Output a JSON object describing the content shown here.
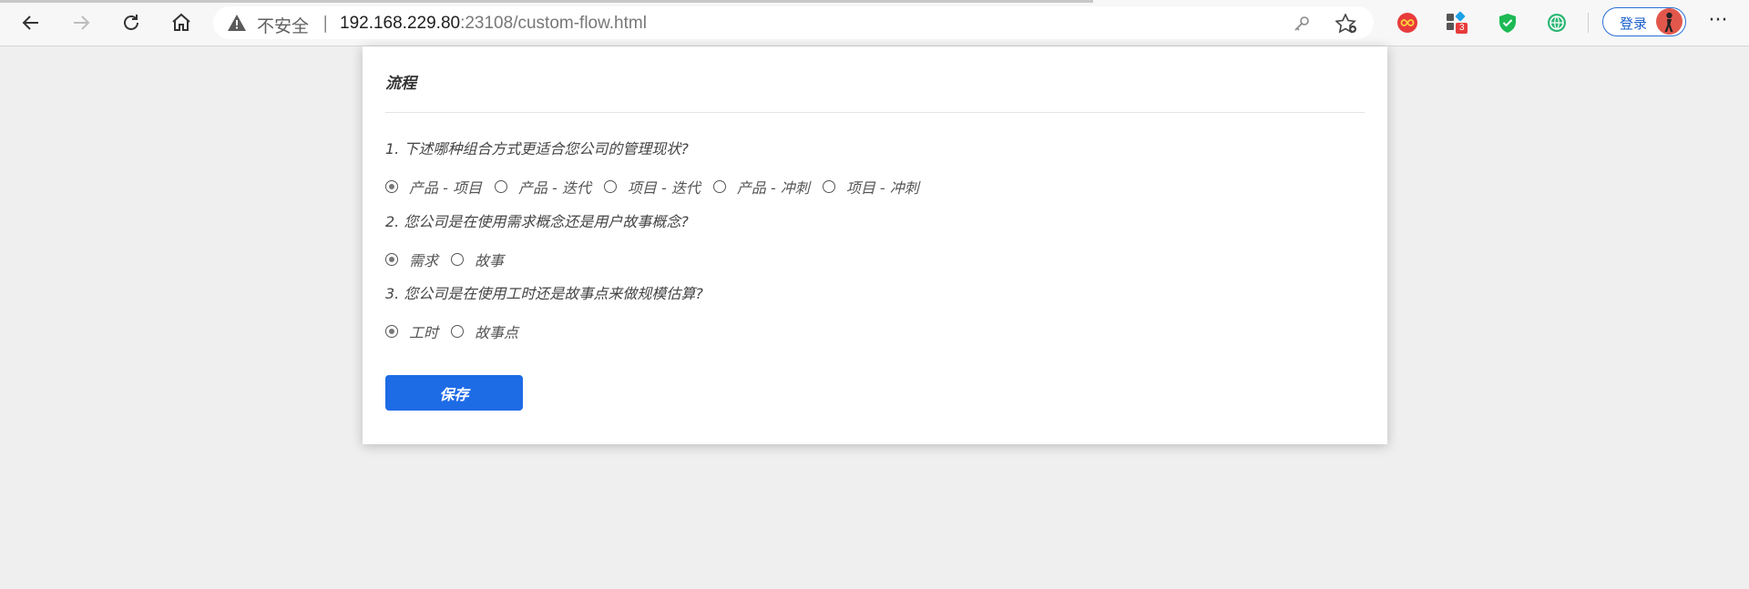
{
  "browser": {
    "security_label": "不安全",
    "separator": "|",
    "url_host": "192.168.229.80",
    "url_rest": ":23108/custom-flow.html",
    "login_label": "登录",
    "ext_badge": "3",
    "more_label": "···",
    "icons": [
      "back-icon",
      "forward-icon",
      "reload-icon",
      "home-icon",
      "warning-icon",
      "key-icon",
      "favorite-star-icon",
      "extension-infinity-icon",
      "extensions-icon",
      "shield-check-icon",
      "vpn-globe-icon",
      "avatar"
    ]
  },
  "page": {
    "title": "流程",
    "questions": [
      {
        "text": "1. 下述哪种组合方式更适合您公司的管理现状?",
        "options": [
          "产品 - 项目",
          "产品 - 迭代",
          "项目 - 迭代",
          "产品 - 冲刺",
          "项目 - 冲刺"
        ],
        "selected": 0
      },
      {
        "text": "2. 您公司是在使用需求概念还是用户故事概念?",
        "options": [
          "需求",
          "故事"
        ],
        "selected": 0
      },
      {
        "text": "3. 您公司是在使用工时还是故事点来做规模估算?",
        "options": [
          "工时",
          "故事点"
        ],
        "selected": 0
      }
    ],
    "save_label": "保存"
  },
  "colors": {
    "accent": "#1e6be6",
    "background": "#efefef",
    "card": "#ffffff"
  }
}
